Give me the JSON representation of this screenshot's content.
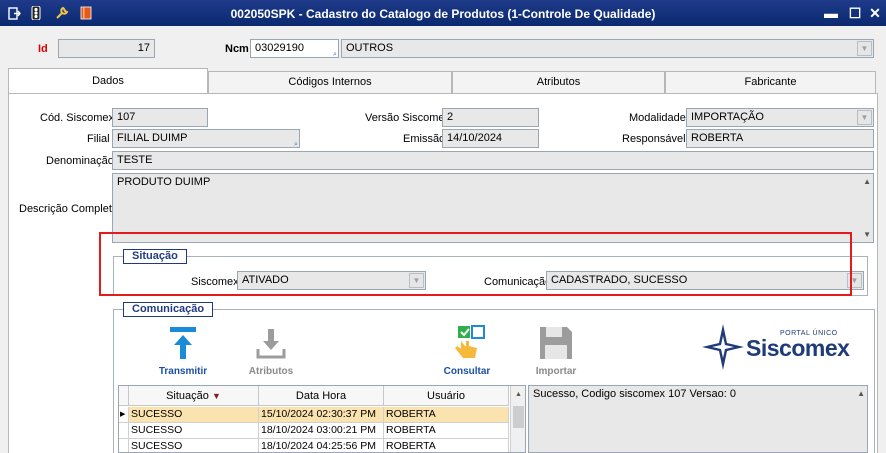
{
  "window": {
    "title": "002050SPK - Cadastro do Catalogo de Produtos (1-Controle De Qualidade)",
    "minimize": "▬",
    "maximize": "☐",
    "close": "✕"
  },
  "header": {
    "id_label": "Id",
    "id_value": "17",
    "ncm_label": "Ncm",
    "ncm_code": "03029190",
    "ncm_desc": "OUTROS"
  },
  "tabs": [
    {
      "label": "Dados"
    },
    {
      "label": "Códigos Internos"
    },
    {
      "label": "Atributos"
    },
    {
      "label": "Fabricante"
    }
  ],
  "dados": {
    "cod_siscomex_label": "Cód. Siscomex",
    "cod_siscomex": "107",
    "versao_label": "Versão Siscomex",
    "versao": "2",
    "modalidade_label": "Modalidade",
    "modalidade": "IMPORTAÇÃO",
    "filial_label": "Filial",
    "filial": "FILIAL DUIMP",
    "emissao_label": "Emissão",
    "emissao": "14/10/2024",
    "responsavel_label": "Responsável",
    "responsavel": "ROBERTA",
    "denominacao_label": "Denominação",
    "denominacao": "TESTE",
    "descricao_label": "Descrição Completa",
    "descricao": "PRODUTO DUIMP"
  },
  "situacao": {
    "title": "Situação",
    "siscomex_label": "Siscomex",
    "siscomex": "ATIVADO",
    "comunicacao_label": "Comunicação",
    "comunicacao": "CADASTRADO, SUCESSO"
  },
  "comunicacao": {
    "title": "Comunicação",
    "tools": [
      {
        "label": "Transmitir"
      },
      {
        "label": "Atributos"
      },
      {
        "label": "Consultar"
      },
      {
        "label": "Importar"
      }
    ],
    "logo_top": "PORTAL ÚNICO",
    "logo_name": "Siscomex",
    "grid_headers": [
      "Situação",
      "Data Hora",
      "Usuário"
    ],
    "rows": [
      {
        "situacao": "SUCESSO",
        "data": "15/10/2024 02:30:37 PM",
        "usuario": "ROBERTA"
      },
      {
        "situacao": "SUCESSO",
        "data": "18/10/2024 03:00:21 PM",
        "usuario": "ROBERTA"
      },
      {
        "situacao": "SUCESSO",
        "data": "18/10/2024 04:25:56 PM",
        "usuario": "ROBERTA"
      }
    ],
    "message": "Sucesso, Codigo siscomex 107 Versao: 0"
  }
}
